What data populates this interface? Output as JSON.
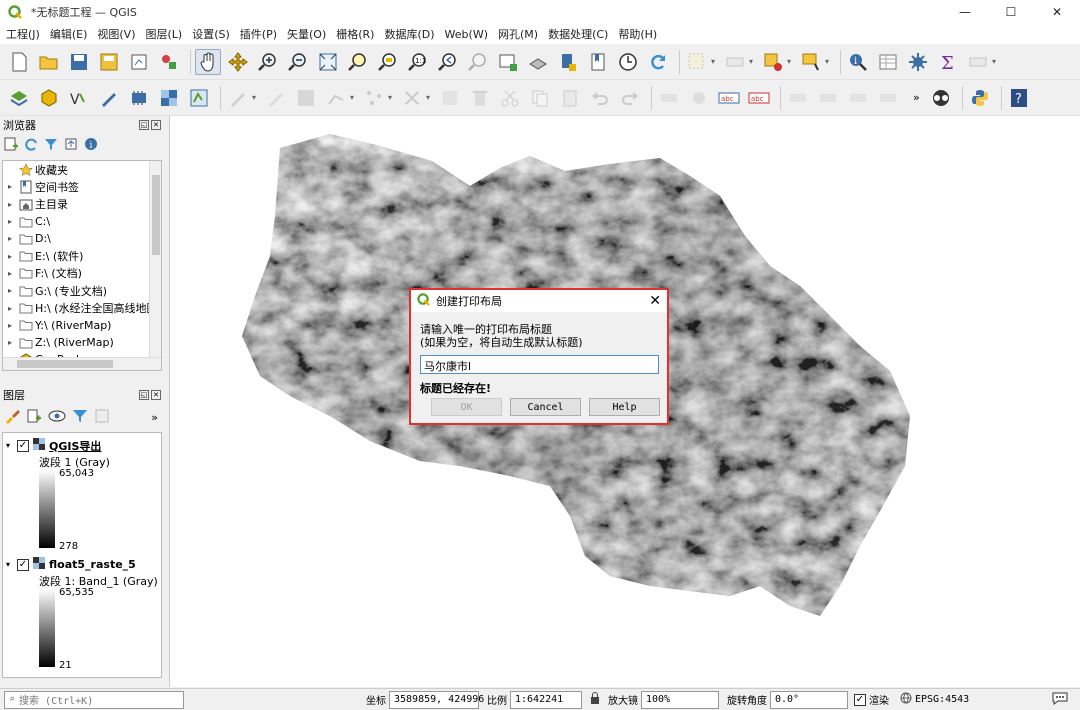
{
  "window": {
    "title": "*无标题工程 — QGIS",
    "minimize": "—",
    "maximize": "☐",
    "close": "✕"
  },
  "menu": [
    "工程(J)",
    "编辑(E)",
    "视图(V)",
    "图层(L)",
    "设置(S)",
    "插件(P)",
    "矢量(O)",
    "栅格(R)",
    "数据库(D)",
    "Web(W)",
    "网孔(M)",
    "数据处理(C)",
    "帮助(H)"
  ],
  "browser": {
    "title": "浏览器",
    "items": [
      {
        "label": "收藏夹",
        "icon": "star-icon",
        "arrow": ""
      },
      {
        "label": "空间书签",
        "icon": "bookmark-icon",
        "arrow": "▸"
      },
      {
        "label": "主目录",
        "icon": "home-folder-icon",
        "arrow": "▸"
      },
      {
        "label": "C:\\",
        "icon": "folder-icon",
        "arrow": "▸"
      },
      {
        "label": "D:\\",
        "icon": "folder-icon",
        "arrow": "▸"
      },
      {
        "label": "E:\\ (软件)",
        "icon": "folder-icon",
        "arrow": "▸"
      },
      {
        "label": "F:\\ (文档)",
        "icon": "folder-icon",
        "arrow": "▸"
      },
      {
        "label": "G:\\ (专业文档)",
        "icon": "folder-icon",
        "arrow": "▸"
      },
      {
        "label": "H:\\ (水经注全国高线地图",
        "icon": "folder-icon",
        "arrow": "▸"
      },
      {
        "label": "Y:\\ (RiverMap)",
        "icon": "folder-icon",
        "arrow": "▸"
      },
      {
        "label": "Z:\\ (RiverMap)",
        "icon": "folder-icon",
        "arrow": "▸"
      },
      {
        "label": "GeoPackage",
        "icon": "geopackage-icon",
        "arrow": ""
      }
    ]
  },
  "layers": {
    "title": "图层",
    "items": [
      {
        "name": "QGIS导出",
        "band": "波段 1 (Gray)",
        "max": "65,043",
        "min": "278"
      },
      {
        "name": "float5_raste_5",
        "band": "波段 1: Band_1 (Gray)",
        "max": "65,535",
        "min": "21"
      }
    ]
  },
  "dialog": {
    "title": "创建打印布局",
    "prompt1": "请输入唯一的打印布局标题",
    "prompt2": "(如果为空，将自动生成默认标题)",
    "value": "马尔康市l",
    "error": "标题已经存在!",
    "ok": "OK",
    "cancel": "Cancel",
    "help": "Help"
  },
  "status": {
    "search_placeholder": "搜索 (Ctrl+K)",
    "coord_label": "坐标",
    "coord_value": "3589859, 424996",
    "scale_label": "比例",
    "scale_value": "1:642241",
    "magnifier_label": "放大镜",
    "magnifier_value": "100%",
    "rotation_label": "旋转角度",
    "rotation_value": "0.0°",
    "render_label": "渲染",
    "crs": "EPSG:4543"
  }
}
